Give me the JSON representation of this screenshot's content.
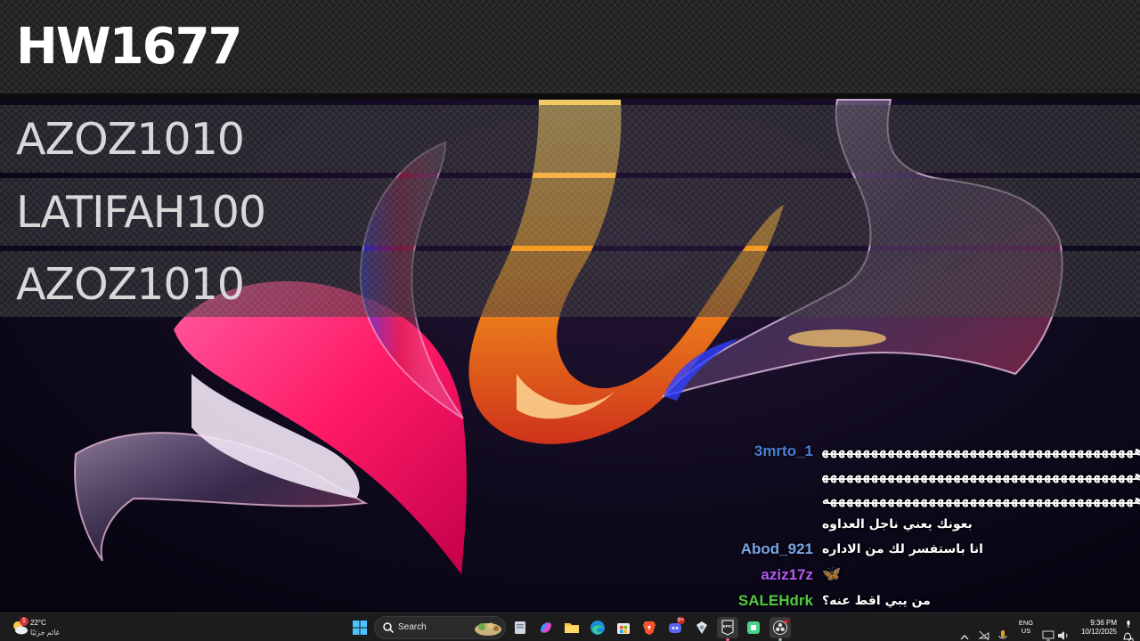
{
  "leaderboard": {
    "rows": [
      "HW1677",
      "AZOZ1010",
      "LATIFAH100",
      "AZOZ1010"
    ]
  },
  "chat": {
    "messages": [
      {
        "user": "3mrto_1",
        "user_color": "#4a7fd0",
        "text": "ههههههههههههههههههههههههههههههههههههههههههههههههههههههههههههههههه"
      },
      {
        "user": "",
        "user_color": "#ffffff",
        "text": "ههههههههههههههههههههههههههههههههههههههههههههههههههههههههههههههههه"
      },
      {
        "user": "",
        "user_color": "#ffffff",
        "text": "ههههههههههههههههههههههههههههههههههههههه الله يكون"
      },
      {
        "user": "",
        "user_color": "#ffffff",
        "text": "بعونك يعني ناجل العداوه"
      },
      {
        "user": "Abod_921",
        "user_color": "#7aa6e6",
        "text": "انا باستفسر لك من الاداره"
      },
      {
        "user": "aziz17z",
        "user_color": "#b45cf2",
        "text": "🦋"
      },
      {
        "user": "SALEHdrk",
        "user_color": "#4ecb3d",
        "text": "من يبي اقط عنه؟"
      }
    ]
  },
  "taskbar": {
    "weather": {
      "temperature": "22°C",
      "condition": "غائم جزئيًا",
      "icon": "partly-cloudy-icon",
      "badge": "1"
    },
    "search_placeholder": "Search",
    "apps": [
      "windows-start-icon",
      "file-icon",
      "copilot-icon",
      "file-explorer-icon",
      "edge-icon",
      "store-icon",
      "brave-icon",
      "discord-icon",
      "app-icon",
      "epic-games-icon",
      "app-green-icon",
      "obs-icon"
    ],
    "discord_badge": "9+",
    "language": {
      "lang": "ENG",
      "region": "US"
    },
    "clock": {
      "time": "9:36 PM",
      "date": "10/12/2025"
    }
  }
}
